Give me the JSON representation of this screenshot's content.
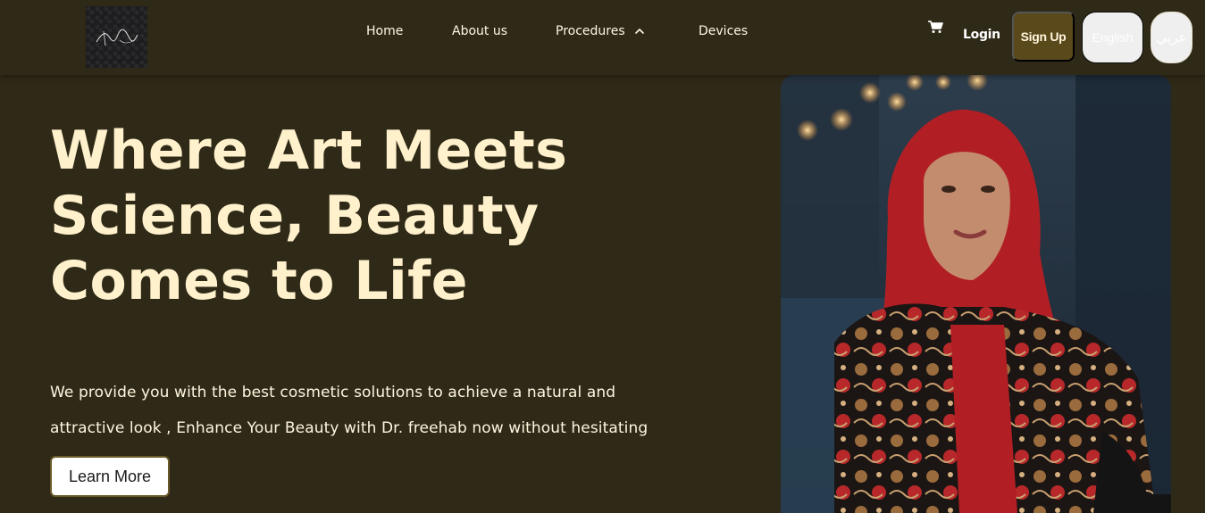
{
  "nav": {
    "home": "Home",
    "about": "About us",
    "procedures": "Procedures",
    "devices": "Devices"
  },
  "actions": {
    "login": "Login",
    "signup": "Sign Up",
    "lang_en": "English",
    "lang_ar": "عربي"
  },
  "hero": {
    "title_lines": [
      "Where Art Meets",
      "Science, Beauty",
      "Comes to Life"
    ],
    "text_lines": [
      "We provide you with the best cosmetic solutions to achieve a natural and",
      "attractive look , Enhance Your Beauty with Dr. freehab now without hesitating"
    ],
    "cta": "Learn More"
  },
  "icons": {
    "cart": "cart-icon",
    "chevron": "chevron-up-icon"
  },
  "colors": {
    "background": "#2f2918",
    "accent": "#5a4a1b",
    "title": "#fff1cc"
  }
}
